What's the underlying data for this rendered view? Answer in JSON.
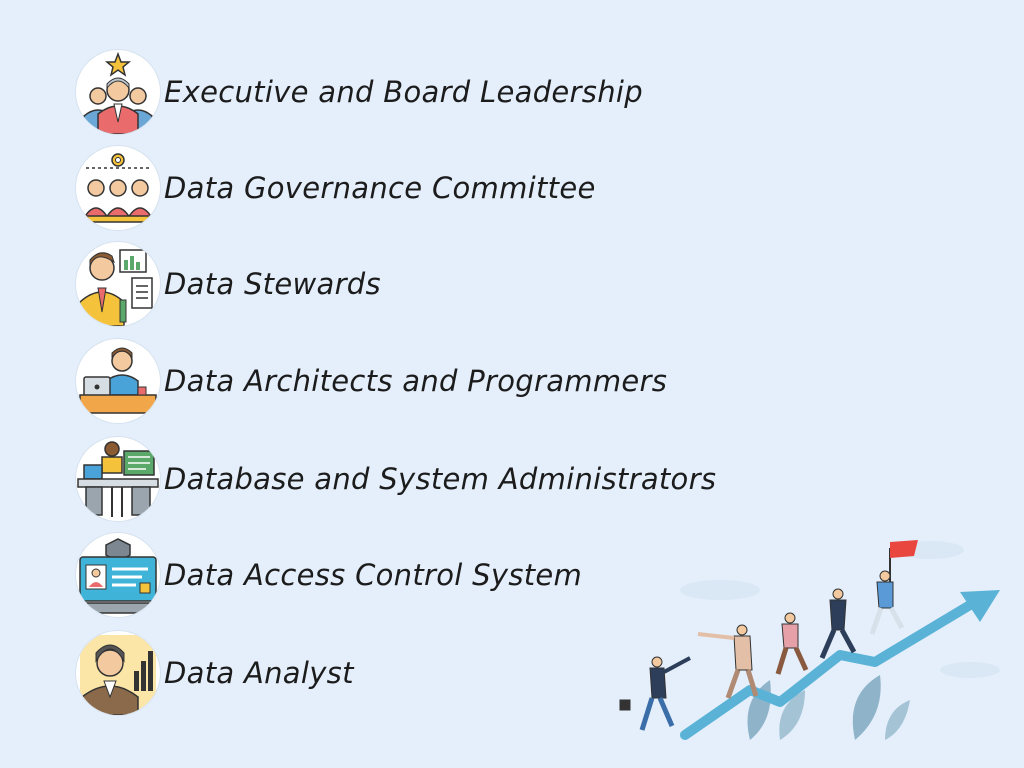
{
  "roles": [
    {
      "label": "Executive and Board Leadership",
      "icon": "executive-leadership-icon"
    },
    {
      "label": "Data Governance Committee",
      "icon": "governance-committee-icon"
    },
    {
      "label": "Data Stewards",
      "icon": "data-steward-icon"
    },
    {
      "label": "Data Architects and Programmers",
      "icon": "programmer-icon"
    },
    {
      "label": "Database and System Administrators",
      "icon": "system-admin-icon"
    },
    {
      "label": "Data Access Control System",
      "icon": "access-control-icon"
    },
    {
      "label": "Data Analyst",
      "icon": "data-analyst-icon"
    }
  ],
  "colors": {
    "background": "#e4effb",
    "arrow": "#5ab3d6",
    "flag": "#e8463f",
    "leaf": "#8fb4c9"
  },
  "illustration": {
    "icon": "team-climbing-arrow-icon"
  }
}
